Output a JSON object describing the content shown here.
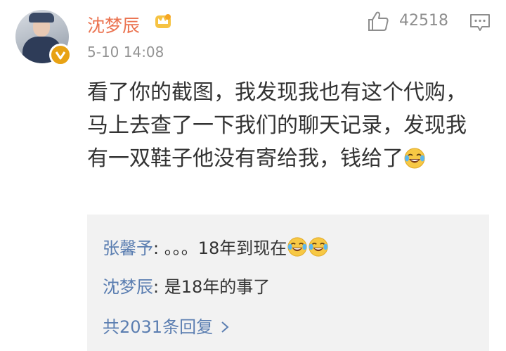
{
  "comment": {
    "username": "沈梦辰",
    "date": "5-10 14:08",
    "like_count": "42518",
    "text": "看了你的截图，我发现我也有这个代购，马上去查了一下我们的聊天记录，发现我有一双鞋子他没有寄给我，钱给了",
    "emoji": "laugh-cry-emoji"
  },
  "replies": [
    {
      "name": "张馨予",
      "sep": ":",
      "text": " 。。。18年到现在",
      "emoji_count": 2
    },
    {
      "name": "沈梦辰",
      "sep": ":",
      "text": " 是18年的事了"
    }
  ],
  "more_replies": "共2031条回复",
  "colors": {
    "username": "#eb7350",
    "reply_name": "#5b7eb1",
    "reply_bg": "#f2f2f2"
  },
  "icons": [
    "verified-badge-icon",
    "crown-icon",
    "thumbs-up-icon",
    "reply-icon",
    "chevron-right-icon"
  ]
}
